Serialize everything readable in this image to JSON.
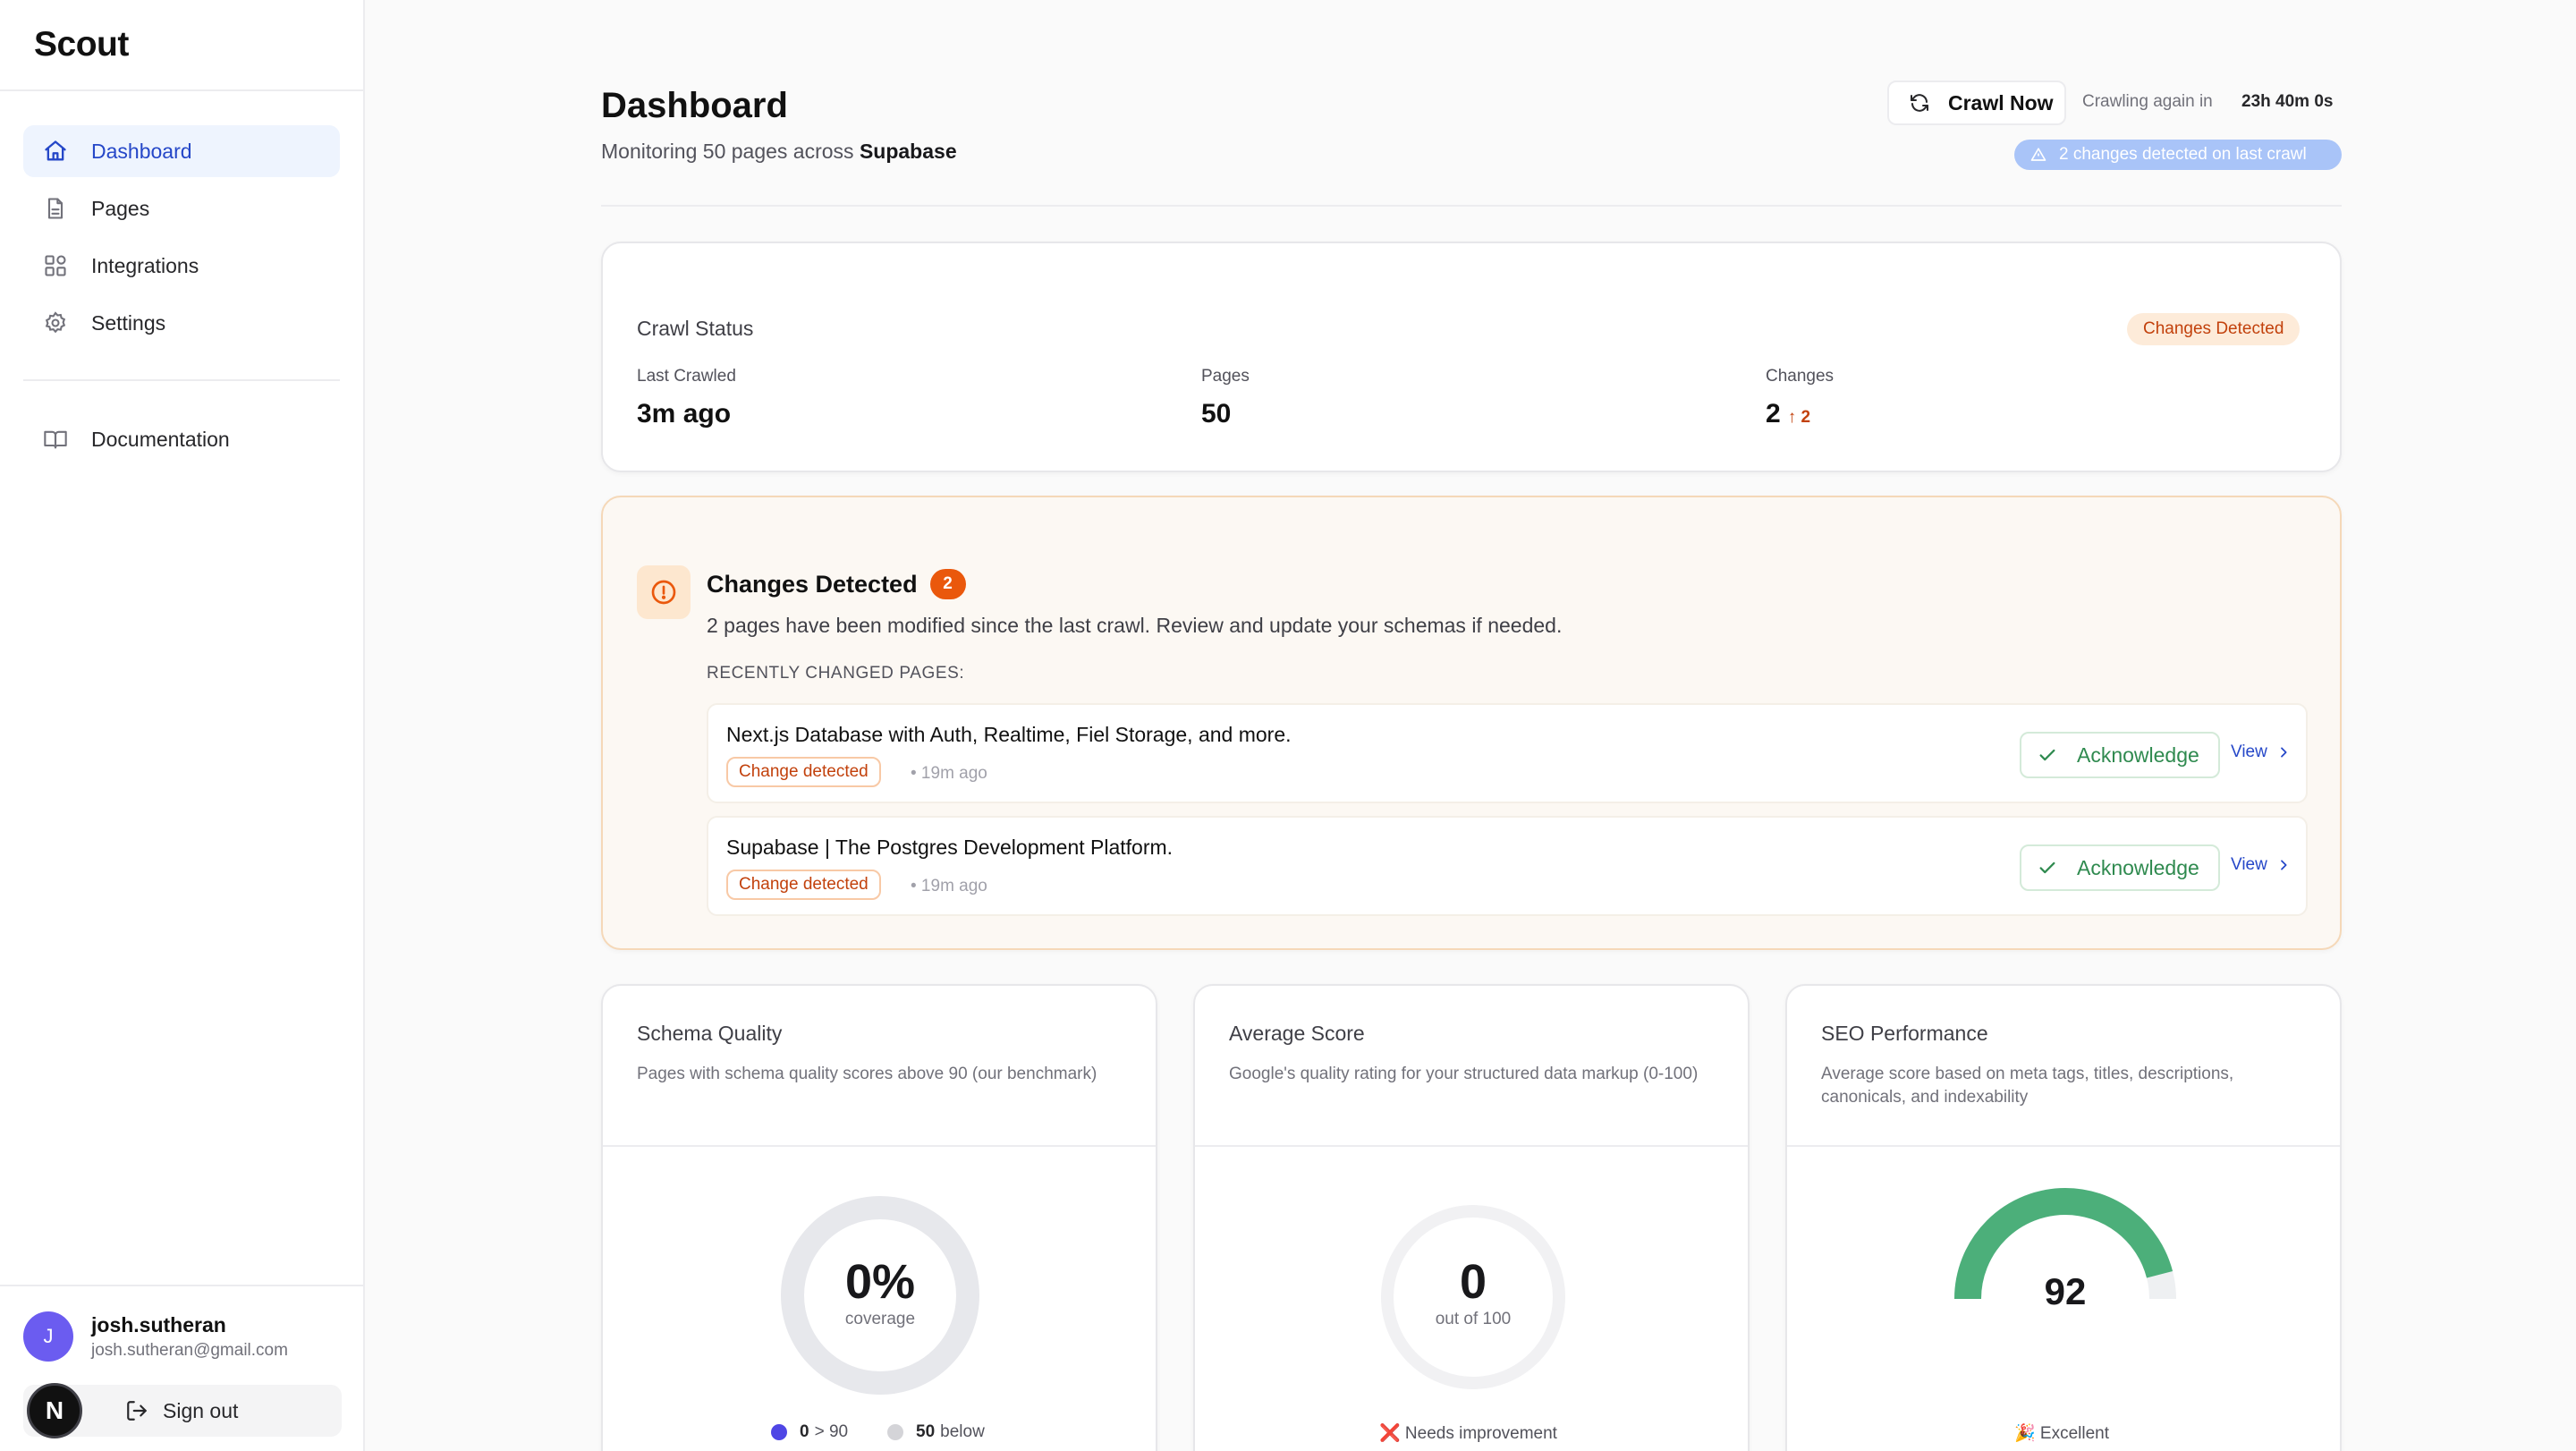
{
  "app": {
    "name": "Scout"
  },
  "sidebar": {
    "items": [
      {
        "label": "Dashboard",
        "icon": "home-icon",
        "active": true
      },
      {
        "label": "Pages",
        "icon": "file-icon"
      },
      {
        "label": "Integrations",
        "icon": "grid-icon"
      },
      {
        "label": "Settings",
        "icon": "gear-icon"
      }
    ],
    "docs": {
      "label": "Documentation",
      "icon": "book-icon"
    },
    "user": {
      "initial": "J",
      "name": "josh.sutheran",
      "email": "josh.sutheran@gmail.com"
    },
    "signout_label": "Sign out",
    "dev_badge": "N"
  },
  "header": {
    "title": "Dashboard",
    "subtitle_prefix": "Monitoring 50 pages across",
    "subtitle_site": "Supabase",
    "crawl_button": "Crawl Now",
    "crawl_again_label": "Crawling again in",
    "crawl_timer": "23h 40m 0s",
    "changes_pill": "2 changes detected on last crawl"
  },
  "crawl_status": {
    "title": "Crawl Status",
    "badge": "Changes Detected",
    "stats": [
      {
        "label": "Last Crawled",
        "value": "3m ago"
      },
      {
        "label": "Pages",
        "value": "50"
      },
      {
        "label": "Changes",
        "value": "2",
        "delta": "2"
      }
    ]
  },
  "changes": {
    "title": "Changes Detected",
    "count": "2",
    "description": "2 pages have been modified since the last crawl. Review and update your schemas if needed.",
    "recent_label": "RECENTLY CHANGED PAGES:",
    "rows": [
      {
        "title": "Next.js Database with Auth, Realtime, Fiel Storage, and more.",
        "badge": "Change detected",
        "time": "• 19m ago",
        "ack": "Acknowledge",
        "view": "View"
      },
      {
        "title": "Supabase | The Postgres Development Platform.",
        "badge": "Change detected",
        "time": "• 19m ago",
        "ack": "Acknowledge",
        "view": "View"
      }
    ]
  },
  "metrics": {
    "schema_quality": {
      "title": "Schema Quality",
      "description": "Pages with schema quality scores above 90 (our benchmark)",
      "value": "0%",
      "caption": "coverage",
      "coverage_fraction": 0,
      "legend": [
        {
          "count": "0",
          "label": "> 90",
          "color": "#4f46e5"
        },
        {
          "count": "50",
          "label": "below",
          "color": "#d4d4d8"
        }
      ]
    },
    "average_score": {
      "title": "Average Score",
      "description": "Google's quality rating for your structured data markup (0-100)",
      "value": "0",
      "caption": "out of 100",
      "score_fraction": 0,
      "status": "❌ Needs improvement"
    },
    "seo_performance": {
      "title": "SEO Performance",
      "description": "Average score based on meta tags, titles, descriptions, canonicals, and indexability",
      "value": "92",
      "score_fraction": 0.92,
      "status": "🎉 Excellent",
      "color": "#4caf7a"
    }
  }
}
